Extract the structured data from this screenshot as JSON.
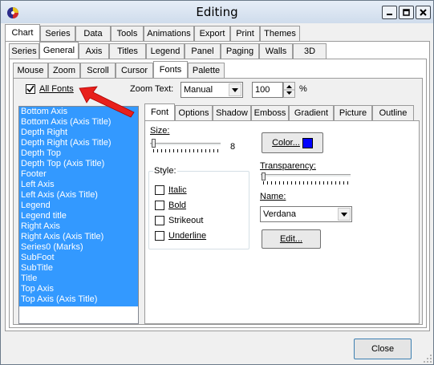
{
  "window": {
    "title": "Editing"
  },
  "tabs_main": [
    "Chart",
    "Series",
    "Data",
    "Tools",
    "Animations",
    "Export",
    "Print",
    "Themes"
  ],
  "tabs_chart": [
    "Series",
    "General",
    "Axis",
    "Titles",
    "Legend",
    "Panel",
    "Paging",
    "Walls",
    "3D"
  ],
  "tabs_general": [
    "Mouse",
    "Zoom",
    "Scroll",
    "Cursor",
    "Fonts",
    "Palette"
  ],
  "fonts_bar": {
    "all_fonts_label": "All Fonts",
    "all_fonts_checked": true,
    "zoom_text_label": "Zoom Text:",
    "zoom_mode": "Manual",
    "zoom_percent": "100",
    "percent_sign": "%"
  },
  "font_items": [
    "Bottom Axis",
    "Bottom Axis (Axis Title)",
    "Depth Right",
    "Depth Right (Axis Title)",
    "Depth Top",
    "Depth Top (Axis Title)",
    "Footer",
    "Left Axis",
    "Left Axis (Axis Title)",
    "Legend",
    "Legend title",
    "Right Axis",
    "Right Axis (Axis Title)",
    "Series0 (Marks)",
    "SubFoot",
    "SubTitle",
    "Title",
    "Top Axis",
    "Top Axis (Axis Title)"
  ],
  "tabs_font": [
    "Font",
    "Options",
    "Shadow",
    "Emboss",
    "Gradient",
    "Picture",
    "Outline"
  ],
  "font_panel": {
    "size_label": "Size:",
    "size_value": "8",
    "style_label": "Style:",
    "styles": [
      "Italic",
      "Bold",
      "Strikeout",
      "Underline"
    ],
    "color_button": "Color...",
    "color_swatch": "#0000ff",
    "transparency_label": "Transparency:",
    "name_label": "Name:",
    "font_name": "Verdana",
    "edit_button": "Edit..."
  },
  "close_button": "Close",
  "colors": {
    "selection": "#3399ff",
    "arrow": "#e8201c"
  }
}
